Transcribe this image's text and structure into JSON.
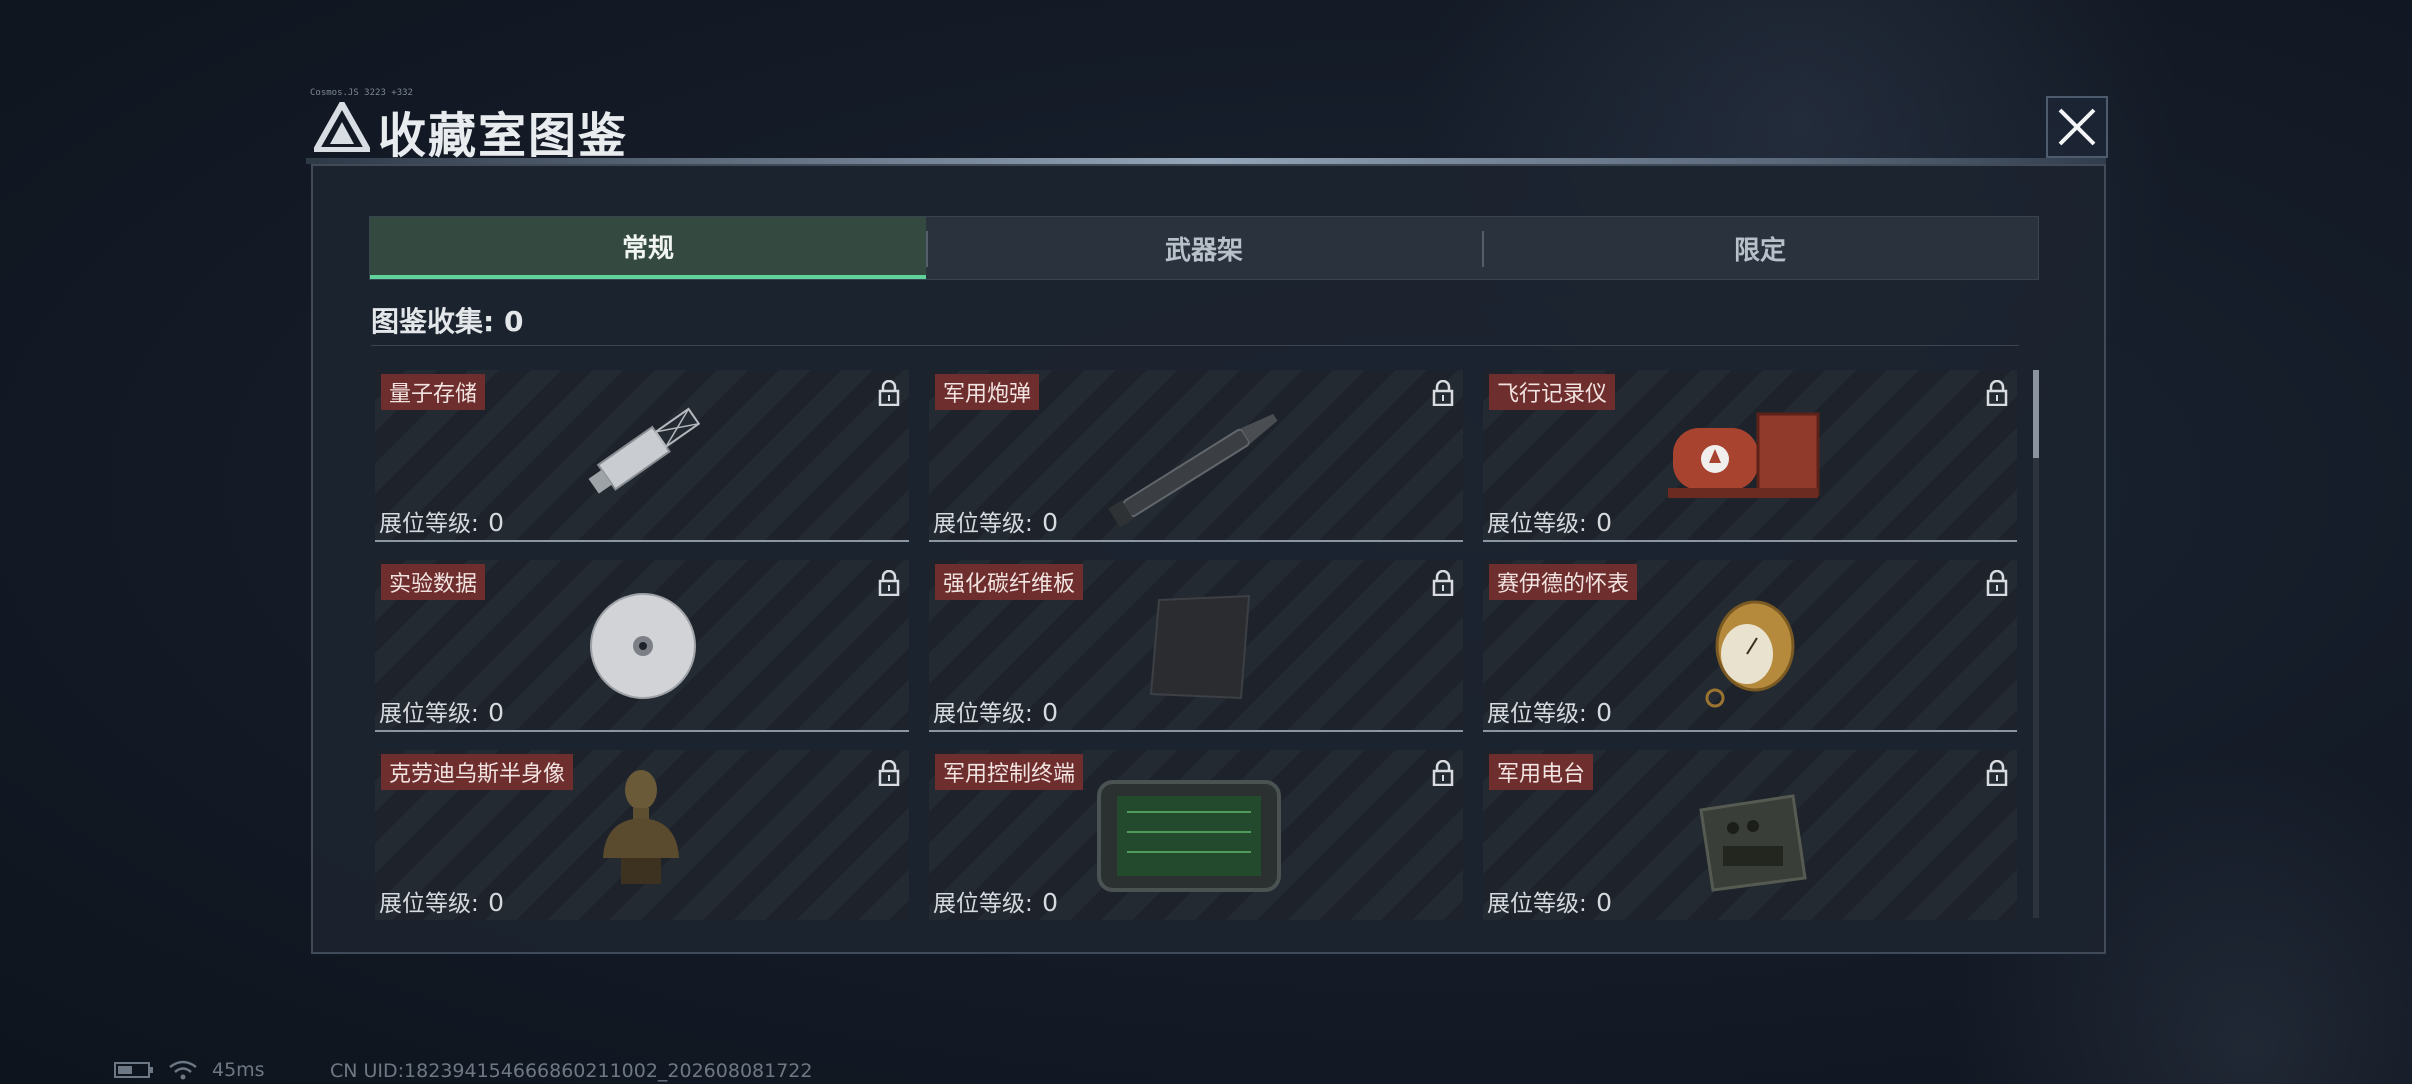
{
  "header": {
    "title": "收藏室图鉴",
    "tiny_tag": "Cosmos.JS 3223 +332"
  },
  "tabs": [
    {
      "label": "常规",
      "active": true
    },
    {
      "label": "武器架",
      "active": false
    },
    {
      "label": "限定",
      "active": false
    }
  ],
  "collection": {
    "label": "图鉴收集: 0"
  },
  "level_label": "展位等级:",
  "items": [
    {
      "name": "量子存储",
      "level": "0",
      "icon": "usb-drive-icon"
    },
    {
      "name": "军用炮弹",
      "level": "0",
      "icon": "artillery-shell-icon"
    },
    {
      "name": "飞行记录仪",
      "level": "0",
      "icon": "flight-recorder-icon"
    },
    {
      "name": "实验数据",
      "level": "0",
      "icon": "disc-icon"
    },
    {
      "name": "强化碳纤维板",
      "level": "0",
      "icon": "carbon-plate-icon"
    },
    {
      "name": "赛伊德的怀表",
      "level": "0",
      "icon": "pocket-watch-icon"
    },
    {
      "name": "克劳迪乌斯半身像",
      "level": "0",
      "icon": "bust-icon"
    },
    {
      "name": "军用控制终端",
      "level": "0",
      "icon": "control-terminal-icon"
    },
    {
      "name": "军用电台",
      "level": "0",
      "icon": "radio-icon"
    }
  ],
  "status": {
    "ping": "45ms",
    "uid": "CN UID:18239415466686021​1002_202608081722"
  },
  "colors": {
    "accent": "#5fd39a",
    "name_tag": "#6e2e2e",
    "panel": "#1c2430"
  }
}
